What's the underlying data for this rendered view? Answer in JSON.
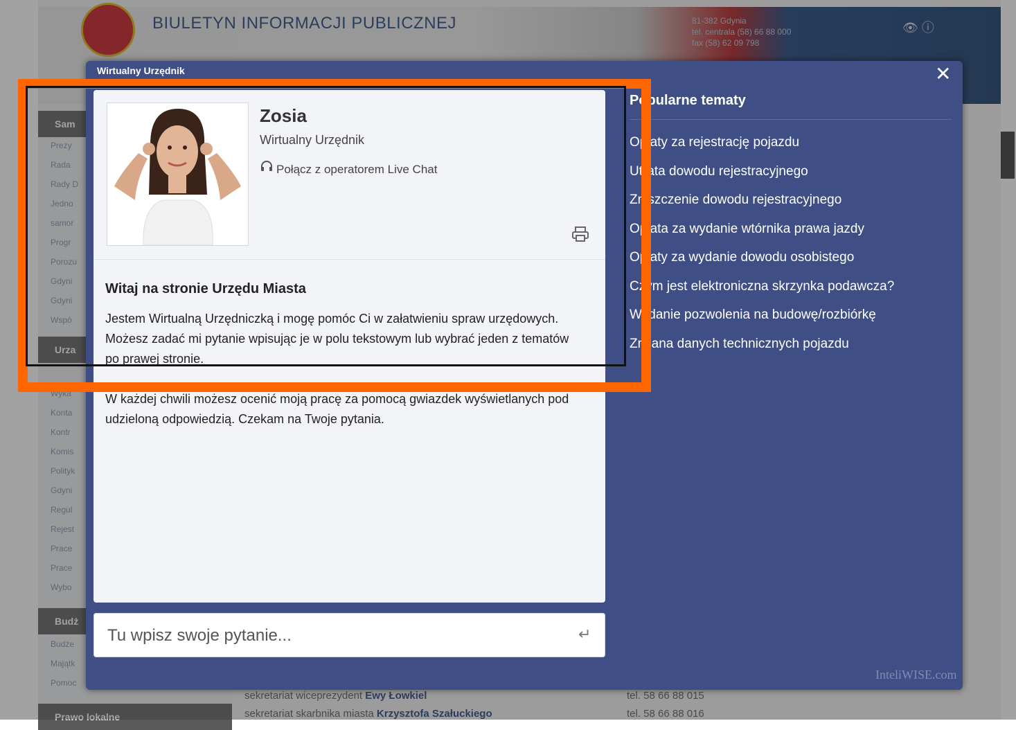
{
  "background": {
    "header_title": "BIULETYN INFORMACJI PUBLICZNEJ",
    "contact_lines": [
      "81-382 Gdynia",
      "tel. centrala (58) 66 88 000",
      "fax (58) 62 09 798"
    ],
    "tools": "👁 ⓘ",
    "sections": [
      "Sam",
      "Urza",
      "Budż",
      "Prawo lokalne"
    ],
    "links_group1": [
      "Prezy",
      "Rada",
      "Rady D",
      "Jedno",
      "samor",
      "Progr",
      "Porozu",
      "Gdyni",
      "Gdyni",
      "Wspó"
    ],
    "links_group2": [
      "Wyka",
      "Konta",
      "Kontr",
      "Komis",
      "Polityk",
      "Gdyni",
      "Regul",
      "Rejest",
      "Prace",
      "Prace",
      "Wybo"
    ],
    "links_group3": [
      "Budże",
      "Majątk",
      "Pomoc"
    ],
    "footer_rows": [
      {
        "prefix": "sekretariat wiceprezydent ",
        "name": "Ewy Łowkiel",
        "phone": "tel. 58 66 88 015"
      },
      {
        "prefix": "sekretariat skarbnika miasta ",
        "name": "Krzysztofa Szałuckiego",
        "phone": "tel. 58 66 88 016"
      }
    ]
  },
  "dialog": {
    "heading": "Wirtualny Urzędnik",
    "close": "✕",
    "agent": {
      "name": "Zosia",
      "role": "Wirtualny Urzędnik",
      "live_chat": "Połącz z operatorem Live Chat"
    },
    "welcome": {
      "title": "Witaj na stronie Urzędu Miasta",
      "p1": "Jestem Wirtualną Urzędniczką i mogę pomóc Ci w załatwieniu spraw urzędowych. Możesz zadać mi pytanie wpisując je w polu tekstowym lub wybrać jeden z tematów po prawej stronie.",
      "p2": "W każdej chwili możesz ocenić moją pracę za pomocą gwiazdek wyświetlanych pod udzieloną odpowiedzią. Czekam na Twoje pytania."
    },
    "input": {
      "placeholder": "Tu wpisz swoje pytanie...",
      "value": ""
    },
    "topics": {
      "title": "Popularne tematy",
      "items": [
        "Opłaty za rejestrację pojazdu",
        "Utrata dowodu rejestracyjnego",
        "Zniszczenie dowodu rejestracyjnego",
        "Opłata za wydanie wtórnika prawa jazdy",
        "Opłaty za wydanie dowodu osobistego",
        "Czym jest elektroniczna skrzynka podawcza?",
        "Wydanie pozwolenia na budowę/rozbiórkę",
        "Zmiana danych technicznych pojazdu"
      ]
    },
    "brand": "InteliWISE.com"
  },
  "colors": {
    "dialog_bg": "#3f4f86",
    "panel_bg": "#f3f4f7",
    "highlight": "#ff6600"
  }
}
